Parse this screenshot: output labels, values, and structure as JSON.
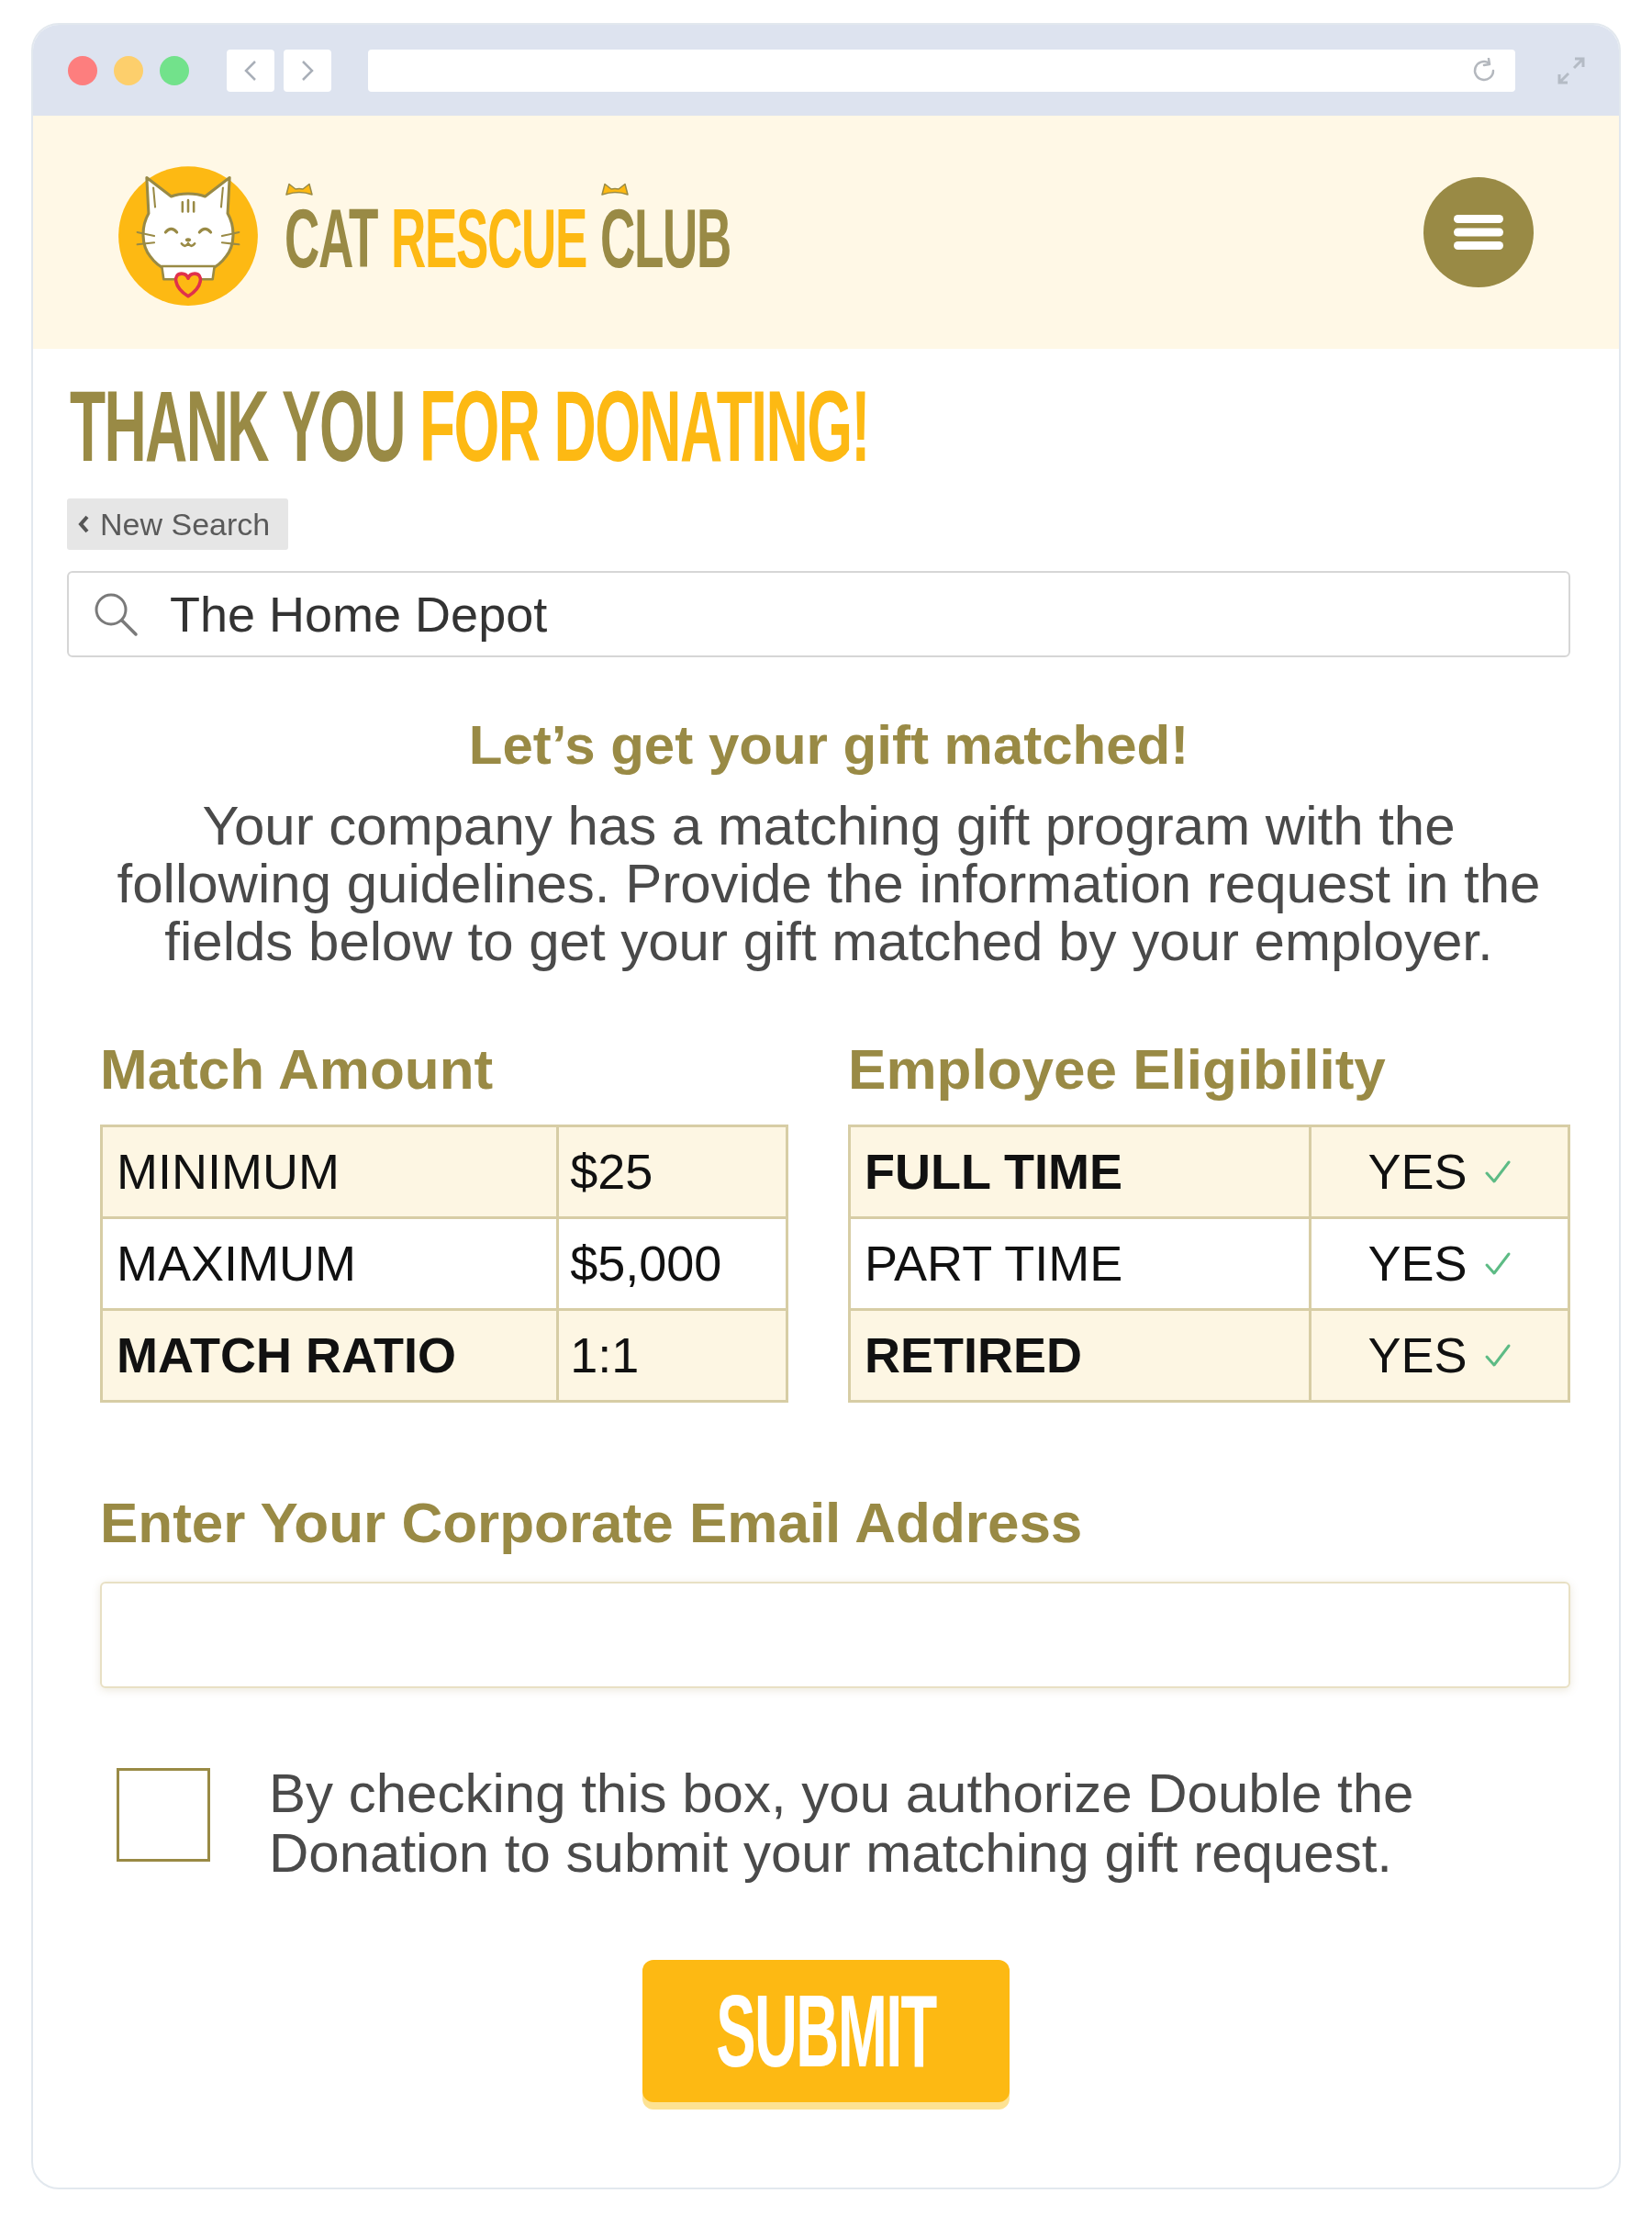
{
  "header": {
    "logo_words": [
      {
        "text": "CAT",
        "accent": false,
        "ears": true
      },
      {
        "text": "RESCUE",
        "accent": true,
        "ears": false
      },
      {
        "text": "CLUB",
        "accent": false,
        "ears": true
      }
    ]
  },
  "heading": {
    "parts": [
      {
        "text": "THANK YOU",
        "accent": false
      },
      {
        "text": "FOR DONATING!",
        "accent": true
      }
    ]
  },
  "back_button": {
    "label": "New Search"
  },
  "search": {
    "value": "The Home Depot"
  },
  "intro": {
    "title": "Let’s get your gift matched!",
    "text": "Your company has a matching gift program with the following guidelines. Provide the information request in the fields below to get your gift matched by your employer."
  },
  "tables": [
    {
      "kind": "amounts",
      "title": "Match Amount",
      "rows": [
        {
          "label": "MINIMUM",
          "value": "$25",
          "bold": false
        },
        {
          "label": "MAXIMUM",
          "value": "$5,000",
          "bold": false
        },
        {
          "label": "MATCH RATIO",
          "value": "1:1",
          "bold": true
        }
      ]
    },
    {
      "kind": "eligibility",
      "title": "Employee Eligibility",
      "rows": [
        {
          "label": "FULL TIME",
          "value": "YES",
          "bold": true,
          "confirmed": true
        },
        {
          "label": "PART TIME",
          "value": "YES",
          "bold": false,
          "confirmed": true
        },
        {
          "label": "RETIRED",
          "value": "YES",
          "bold": true,
          "confirmed": true
        }
      ]
    }
  ],
  "email": {
    "label": "Enter Your Corporate Email Address"
  },
  "consent": {
    "checked": false,
    "text": "By checking this box, you authorize Double the Donation to submit your matching gift request."
  },
  "submit": {
    "label": "SUBMIT"
  }
}
